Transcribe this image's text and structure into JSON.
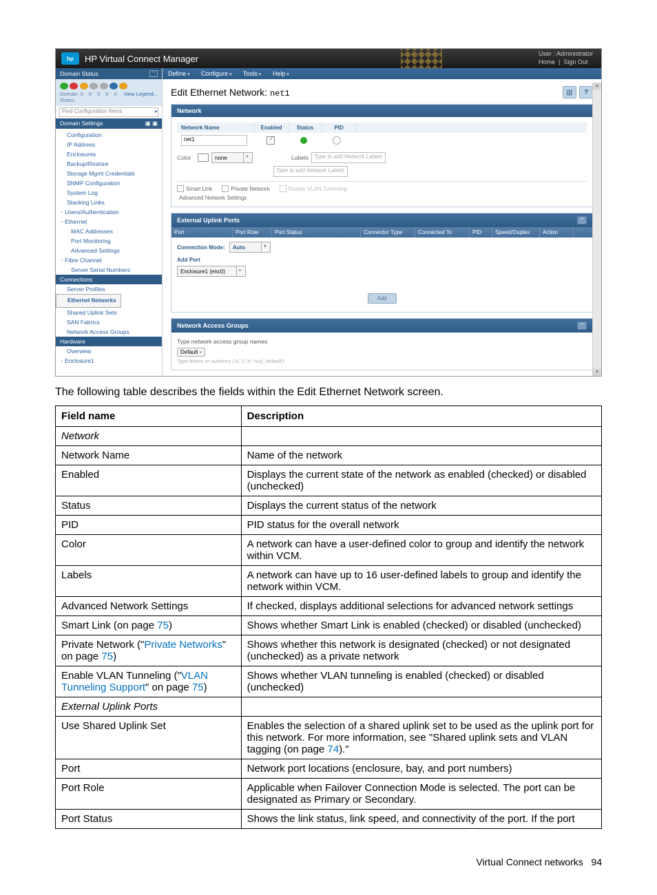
{
  "header": {
    "product": "HP Virtual Connect Manager",
    "user_line": "User : Administrator",
    "links": [
      "Home",
      "Sign Out"
    ]
  },
  "menu": [
    "Define",
    "Configure",
    "Tools",
    "Help"
  ],
  "left": {
    "title": "Domain Status",
    "status_label": "Domain\nStatus",
    "status_nums": [
      "0",
      "0",
      "0",
      "0",
      "0"
    ],
    "view_legend": "View Legend...",
    "find_placeholder": "Find Configuration Items",
    "settings_bar": "Domain Settings",
    "tree": {
      "settings": [
        "Configuration",
        "IP Address",
        "Enclosures",
        "Backup/Restore",
        "Storage Mgmt Credentials",
        "SNMP Configuration",
        "System Log",
        "Stacking Links"
      ],
      "groups": [
        {
          "label": "Users/Authentication",
          "items": []
        },
        {
          "label": "Ethernet",
          "items": [
            "MAC Addresses",
            "Port Monitoring",
            "Advanced Settings"
          ]
        },
        {
          "label": "Fibre Channel",
          "items": [
            "Server Serial Numbers"
          ]
        }
      ],
      "connections_bar": "Connections",
      "connections": [
        "Server Profiles",
        "Ethernet Networks",
        "Shared Uplink Sets",
        "SAN Fabrics",
        "Network Access Groups"
      ],
      "hardware_bar": "Hardware",
      "hardware": [
        "Overview",
        "Enclosure1"
      ]
    }
  },
  "page_title": "Edit Ethernet Network:",
  "page_title_arg": "net1",
  "network_panel": {
    "title": "Network",
    "columns": [
      "Network Name",
      "Enabled",
      "Status",
      "PID"
    ],
    "network_name": "net1",
    "color_label": "Color",
    "color_value": "none",
    "labels_label": "Labels",
    "labels_ph1": "Type to add Network Labels",
    "labels_ph2": "Type to add Network Labels",
    "flags": [
      "Smart Link",
      "Private Network",
      "Enable VLAN Tunneling"
    ],
    "adv": "Advanced Network Settings"
  },
  "uplink_panel": {
    "title": "External Uplink Ports",
    "columns": [
      "Port",
      "Port Role",
      "Port Status",
      "Connector Type",
      "Connected To",
      "PID",
      "Speed/Duplex",
      "Action"
    ],
    "conn_mode_label": "Connection Mode:",
    "conn_mode_value": "Auto",
    "add_port_label": "Add Port",
    "enclosure_value": "Enclosure1 (enc0)",
    "add_btn": "Add"
  },
  "nag_panel": {
    "title": "Network Access Groups",
    "field_label": "Type network access group names",
    "tag": "Default",
    "hint": "Type letters or numbers ('a','2','e','rusj','default')"
  },
  "caption_text": "The following table describes the fields within the Edit Ethernet Network screen.",
  "fields_table": {
    "headers": [
      "Field name",
      "Description"
    ],
    "rows": [
      {
        "name": "Network",
        "ital": true,
        "desc": ""
      },
      {
        "name": "Network Name",
        "desc": "Name of the network"
      },
      {
        "name": "Enabled",
        "desc": "Displays the current state of the network as enabled (checked) or disabled (unchecked)"
      },
      {
        "name": "Status",
        "desc": "Displays the current status of the network"
      },
      {
        "name": "PID",
        "desc": "PID status for the overall network"
      },
      {
        "name": "Color",
        "desc": "A network can have a user-defined color to group and identify the network within VCM."
      },
      {
        "name": "Labels",
        "desc": "A network can have up to 16 user-defined labels to group and identify the network within VCM."
      },
      {
        "name": "Advanced Network Settings",
        "desc": "If checked, displays additional selections for advanced network settings"
      },
      {
        "name_parts": [
          "Smart Link (on page ",
          {
            "link": "75"
          },
          ")"
        ],
        "desc": "Shows whether Smart Link is enabled (checked) or disabled (unchecked)"
      },
      {
        "name_parts": [
          "Private Network (\"",
          {
            "link": "Private Networks"
          },
          "\" on page ",
          {
            "link": "75"
          },
          ")"
        ],
        "desc": "Shows whether this network is designated (checked) or not designated (unchecked) as a private network"
      },
      {
        "name_parts": [
          "Enable VLAN Tunneling (\"",
          {
            "link": "VLAN Tunneling Support"
          },
          "\" on page ",
          {
            "link": "75"
          },
          ")"
        ],
        "desc": "Shows whether VLAN tunneling is enabled (checked) or disabled (unchecked)"
      },
      {
        "name": "External Uplink Ports",
        "ital": true,
        "desc": ""
      },
      {
        "name": "Use Shared Uplink Set",
        "desc_parts": [
          "Enables the selection of a shared uplink set to be used as the uplink port for this network. For more information, see \"Shared uplink sets and VLAN tagging (on page ",
          {
            "link": "74"
          },
          ").\""
        ]
      },
      {
        "name": "Port",
        "desc": "Network port locations (enclosure, bay, and port numbers)"
      },
      {
        "name": "Port Role",
        "desc": "Applicable when Failover Connection Mode is selected. The port can be designated as Primary or Secondary."
      },
      {
        "name": "Port Status",
        "desc": "Shows the link status, link speed, and connectivity of the port. If the port"
      }
    ]
  },
  "footer": {
    "section": "Virtual Connect networks",
    "page": "94"
  }
}
